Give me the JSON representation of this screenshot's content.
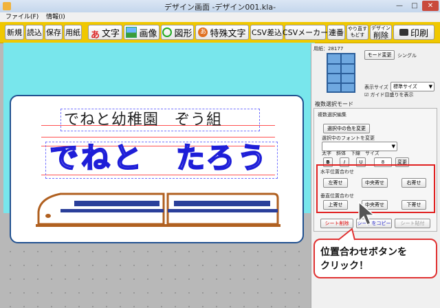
{
  "window": {
    "title": "デザイン画面 -デザイン001.kla-",
    "controls": [
      "—",
      "□",
      "✕"
    ]
  },
  "menu": [
    "ファイル(F)",
    "情報(I)"
  ],
  "toolbar": {
    "new": "新規",
    "open": "読込",
    "save": "保存",
    "paper": "用紙",
    "text": "文字",
    "image": "画像",
    "shape": "図形",
    "special_text": "特殊文字",
    "csv_insert": "CSV差込",
    "csv_maker": "CSVメーカー",
    "serial": "連番",
    "redo_top": "やり直す",
    "redo_bottom": "もどす",
    "design_delete_top": "デザイン",
    "design_delete_bottom": "削除",
    "print": "印刷"
  },
  "canvas": {
    "caption": "でねと幼稚園　ぞう組",
    "name": "でねと　たろう"
  },
  "panel": {
    "paper_label": "用紙：28177",
    "mode_change": "モード変更",
    "mode_value": "シングル",
    "display_size_label": "表示サイズ",
    "display_size_value": "標準サイズ",
    "guide_checkbox": "ガイド目盛りを表示",
    "multi_select_mode": "複数選択モード",
    "multi_edit_group": "複数選択編集",
    "change_color_btn": "選択中の色を変更",
    "font_change_label": "選択中のフォントを変更",
    "font_styles_label": "太字　斜体　下線　サイズ",
    "bold": "B",
    "italic": "I",
    "underline": "U",
    "size_value": "8",
    "change_btn": "変更",
    "horizontal_label": "水平位置合わせ",
    "left_align": "左寄せ",
    "center_align_h": "中央寄せ",
    "right_align": "右寄せ",
    "vertical_label": "垂直位置合わせ",
    "top_align": "上寄せ",
    "center_align_v": "中央寄せ",
    "bottom_align": "下寄せ",
    "sheet_delete": "シート削除",
    "sheet_copy": "シートをコピー",
    "sheet_paste": "シート貼付"
  },
  "callout": {
    "line1": "位置合わせボタンを",
    "line2": "クリック！"
  }
}
